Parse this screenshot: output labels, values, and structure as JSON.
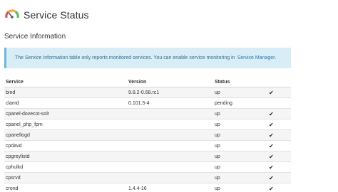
{
  "header": {
    "title": "Service Status",
    "icon": "gauge-icon"
  },
  "section": {
    "title": "Service Information"
  },
  "info": {
    "text": "The Service Information table only reports monitored services. You can enable service monitoring in",
    "link_label": "Service Manager",
    "suffix": "."
  },
  "table": {
    "headers": {
      "service": "Service",
      "version": "Version",
      "status": "Status"
    },
    "rows": [
      {
        "service": "bind",
        "version": "9.8.2-0.68.rc1",
        "status": "up",
        "check": "✔"
      },
      {
        "service": "clamd",
        "version": "0.101.5-4",
        "status": "pending",
        "check": ""
      },
      {
        "service": "cpanel-dovecot-solr",
        "version": "",
        "status": "up",
        "check": "✔"
      },
      {
        "service": "cpanel_php_fpm",
        "version": "",
        "status": "up",
        "check": "✔"
      },
      {
        "service": "cpanellogd",
        "version": "",
        "status": "up",
        "check": "✔"
      },
      {
        "service": "cpdavd",
        "version": "",
        "status": "up",
        "check": "✔"
      },
      {
        "service": "cpgreylistd",
        "version": "",
        "status": "up",
        "check": "✔"
      },
      {
        "service": "cphulkd",
        "version": "",
        "status": "up",
        "check": "✔"
      },
      {
        "service": "cpsrvd",
        "version": "",
        "status": "up",
        "check": "✔"
      },
      {
        "service": "crond",
        "version": "1.4.4-16",
        "status": "up",
        "check": "✔"
      }
    ]
  },
  "colors": {
    "info_bg": "#d9edf7",
    "info_border": "#6fb6dd",
    "link": "#2d7ab8"
  }
}
